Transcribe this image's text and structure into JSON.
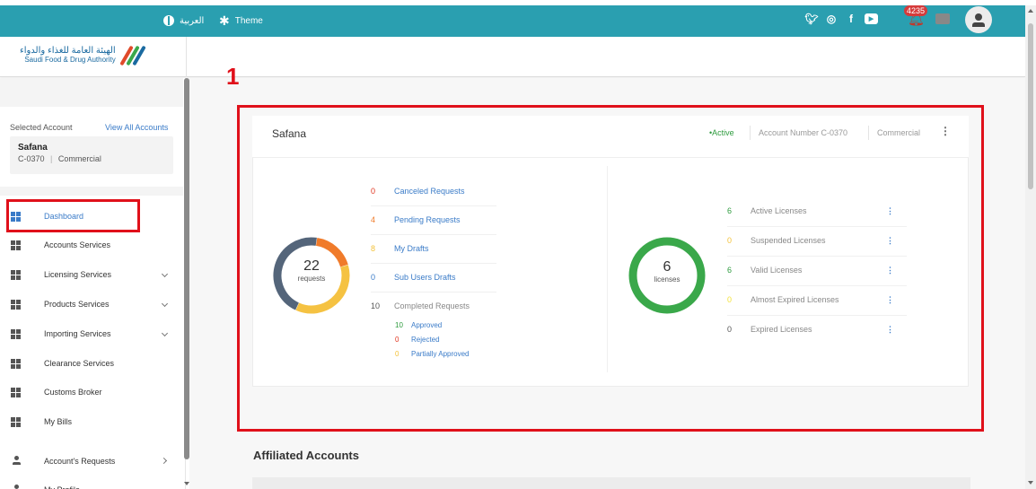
{
  "topbar": {
    "language_label": "العربية",
    "theme_label": "Theme",
    "social_icons": [
      "twitter-icon",
      "instagram-icon",
      "facebook-icon",
      "youtube-icon"
    ]
  },
  "header": {
    "logo_arabic": "الهيئة العامة للغذاء والدواء",
    "logo_english": "Saudi Food & Drug Authority",
    "notification_count": "4235"
  },
  "sidebar": {
    "selected_account_label": "Selected Account",
    "view_all_label": "View All Accounts",
    "account_name": "Safana",
    "account_number": "C-0370",
    "account_type": "Commercial",
    "items": [
      {
        "label": "Dashboard",
        "active": true,
        "chevron": "none"
      },
      {
        "label": "Accounts Services",
        "active": false,
        "chevron": "none"
      },
      {
        "label": "Licensing Services",
        "active": false,
        "chevron": "down"
      },
      {
        "label": "Products Services",
        "active": false,
        "chevron": "down"
      },
      {
        "label": "Importing Services",
        "active": false,
        "chevron": "down"
      },
      {
        "label": "Clearance Services",
        "active": false,
        "chevron": "none"
      },
      {
        "label": "Customs Broker",
        "active": false,
        "chevron": "none"
      },
      {
        "label": "My Bills",
        "active": false,
        "chevron": "none"
      },
      {
        "label": "Account's Requests",
        "active": false,
        "chevron": "right"
      },
      {
        "label": "My Profile",
        "active": false,
        "chevron": "none"
      }
    ]
  },
  "annotation": {
    "step": "1"
  },
  "panel": {
    "title": "Safana",
    "status": "•Active",
    "account_number": "Account Number C-0370",
    "account_type": "Commercial"
  },
  "requests": {
    "total": "22",
    "unit": "requests",
    "rows": [
      {
        "count": "0",
        "label": "Canceled Requests",
        "color": "#e0341e"
      },
      {
        "count": "4",
        "label": "Pending Requests",
        "color": "#f07b2a"
      },
      {
        "count": "8",
        "label": "My Drafts",
        "color": "#f3c23a"
      },
      {
        "count": "0",
        "label": "Sub Users Drafts",
        "color": "#3a7bc8"
      },
      {
        "count": "10",
        "label": "Completed Requests",
        "color": "#555555"
      }
    ],
    "completed_breakdown": [
      {
        "count": "10",
        "label": "Approved",
        "color": "#2e9b3e"
      },
      {
        "count": "0",
        "label": "Rejected",
        "color": "#e0341e"
      },
      {
        "count": "0",
        "label": "Partially Approved",
        "color": "#f3c23a"
      }
    ],
    "donut_segments": [
      {
        "name": "Pending",
        "value": 4,
        "color": "#f07b2a"
      },
      {
        "name": "Drafts",
        "value": 8,
        "color": "#f5c242"
      },
      {
        "name": "Completed",
        "value": 10,
        "color": "#54657a"
      }
    ]
  },
  "licenses": {
    "total": "6",
    "unit": "licenses",
    "color": "#3aa84a",
    "rows": [
      {
        "count": "6",
        "label": "Active Licenses",
        "color": "#2e9b3e"
      },
      {
        "count": "0",
        "label": "Suspended Licenses",
        "color": "#f3c23a"
      },
      {
        "count": "6",
        "label": "Valid Licenses",
        "color": "#2e9b3e"
      },
      {
        "count": "0",
        "label": "Almost Expired Licenses",
        "color": "#f3e23a"
      },
      {
        "count": "0",
        "label": "Expired Licenses",
        "color": "#555555"
      }
    ]
  },
  "affiliated": {
    "title": "Affiliated Accounts"
  },
  "colors": {
    "topbar": "#2a9fb0",
    "accent_link": "#3a7bc8",
    "highlight": "#e0101a"
  }
}
